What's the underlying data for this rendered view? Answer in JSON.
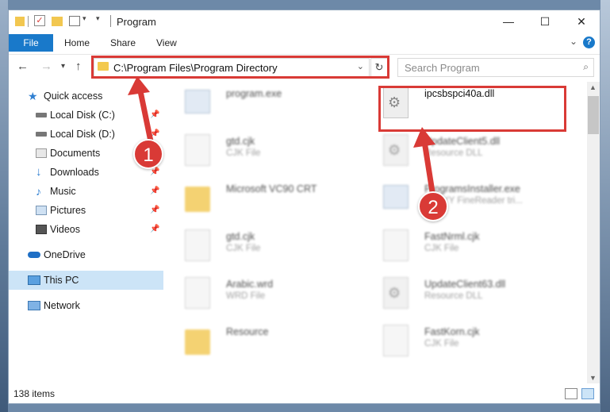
{
  "window": {
    "title": "Program"
  },
  "ribbon": {
    "tabs": [
      "File",
      "Home",
      "Share",
      "View"
    ],
    "help": "?"
  },
  "nav": {
    "address": "C:\\Program Files\\Program Directory",
    "search_placeholder": "Search Program"
  },
  "sidebar": {
    "items": [
      {
        "label": "Quick access",
        "icon": "star-icon"
      },
      {
        "label": "Local Disk (C:)",
        "icon": "drive-icon"
      },
      {
        "label": "Local Disk (D:)",
        "icon": "drive-icon"
      },
      {
        "label": "Documents",
        "icon": "documents-icon"
      },
      {
        "label": "Downloads",
        "icon": "download-icon"
      },
      {
        "label": "Music",
        "icon": "music-icon"
      },
      {
        "label": "Pictures",
        "icon": "pictures-icon"
      },
      {
        "label": "Videos",
        "icon": "videos-icon"
      },
      {
        "label": "OneDrive",
        "icon": "cloud-icon"
      },
      {
        "label": "This PC",
        "icon": "pc-icon"
      },
      {
        "label": "Network",
        "icon": "network-icon"
      }
    ]
  },
  "files": [
    {
      "name": "program.exe",
      "type": ""
    },
    {
      "name": "ipcsbspci40a.dll",
      "type": ""
    },
    {
      "name": "gtd.cjk",
      "type": "CJK File"
    },
    {
      "name": "UpdateClient5.dll",
      "type": "Resource DLL"
    },
    {
      "name": "Microsoft VC90 CRT",
      "type": ""
    },
    {
      "name": "ProgramsInstaller.exe",
      "type": "ABBYY FineReader tri..."
    },
    {
      "name": "gtd.cjk",
      "type": "CJK File"
    },
    {
      "name": "FastNrml.cjk",
      "type": "CJK File"
    },
    {
      "name": "Arabic.wrd",
      "type": "WRD File"
    },
    {
      "name": "UpdateClient63.dll",
      "type": "Resource DLL"
    },
    {
      "name": "Resource",
      "type": ""
    },
    {
      "name": "FastKorn.cjk",
      "type": "CJK File"
    }
  ],
  "status": {
    "items_count": "138 items"
  },
  "annotations": {
    "badge1": "1",
    "badge2": "2",
    "color": "#d93a36"
  }
}
